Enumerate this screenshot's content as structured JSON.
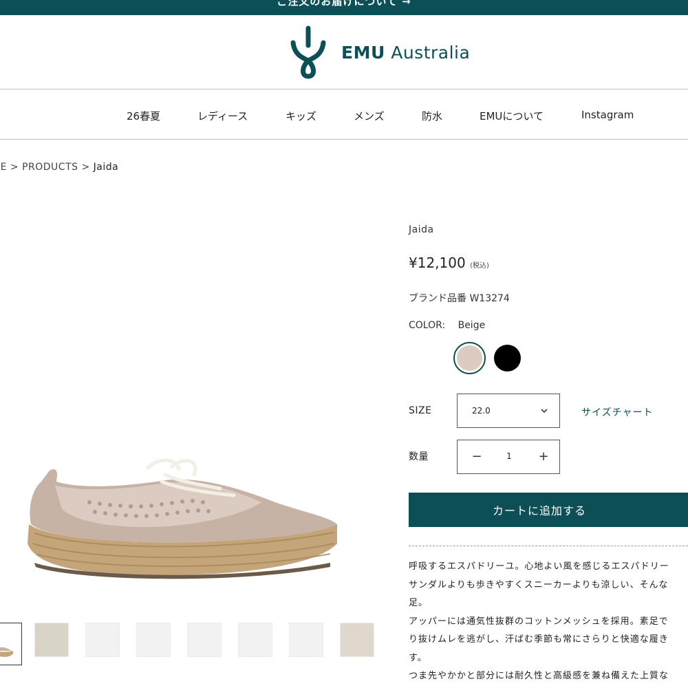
{
  "announcement": "ご注文のお届けについて →",
  "brand": {
    "name_bold": "EMU",
    "name_rest": "Australia",
    "color": "#0d4f57"
  },
  "nav": {
    "items": [
      "26春夏",
      "レディース",
      "キッズ",
      "メンズ",
      "防水",
      "EMUについて",
      "Instagram"
    ]
  },
  "breadcrumb": {
    "home": "ME",
    "sep": ">",
    "products": "PRODUCTS",
    "current": "Jaida"
  },
  "product": {
    "name": "Jaida",
    "price": "¥12,100",
    "tax_note": "(税込)",
    "sku_label": "ブランド品番",
    "sku": "W13274",
    "color_label": "COLOR:",
    "color_value": "Beige",
    "colors": [
      {
        "name": "Beige",
        "hex": "#dccbc0",
        "selected": true
      },
      {
        "name": "Black",
        "hex": "#000000",
        "selected": false
      }
    ],
    "size_label": "SIZE",
    "size_value": "22.0",
    "size_chart_link": "サイズチャート",
    "qty_label": "数量",
    "qty_minus": "−",
    "qty_value": "1",
    "qty_plus": "+",
    "add_to_cart": "カートに追加する"
  },
  "description": [
    "呼吸するエスパドリーユ。心地よい風を感じるエスパドリー",
    "サンダルよりも歩きやすくスニーカーよりも涼しい、そんな",
    "足。",
    "アッパーには通気性抜群のコットンメッシュを採用。素足で",
    "り抜けムレを逃がし、汗ばむ季節も常にさらりと快適な履き",
    "す。",
    "つま先やかかと部分には耐久性と高級感を兼ね備えた上質な"
  ],
  "thumbnails": [
    "side-beige",
    "model-beige",
    "top-beige",
    "back-beige",
    "side-grey",
    "side-grey-2",
    "sole-beige",
    "detail-beige"
  ]
}
